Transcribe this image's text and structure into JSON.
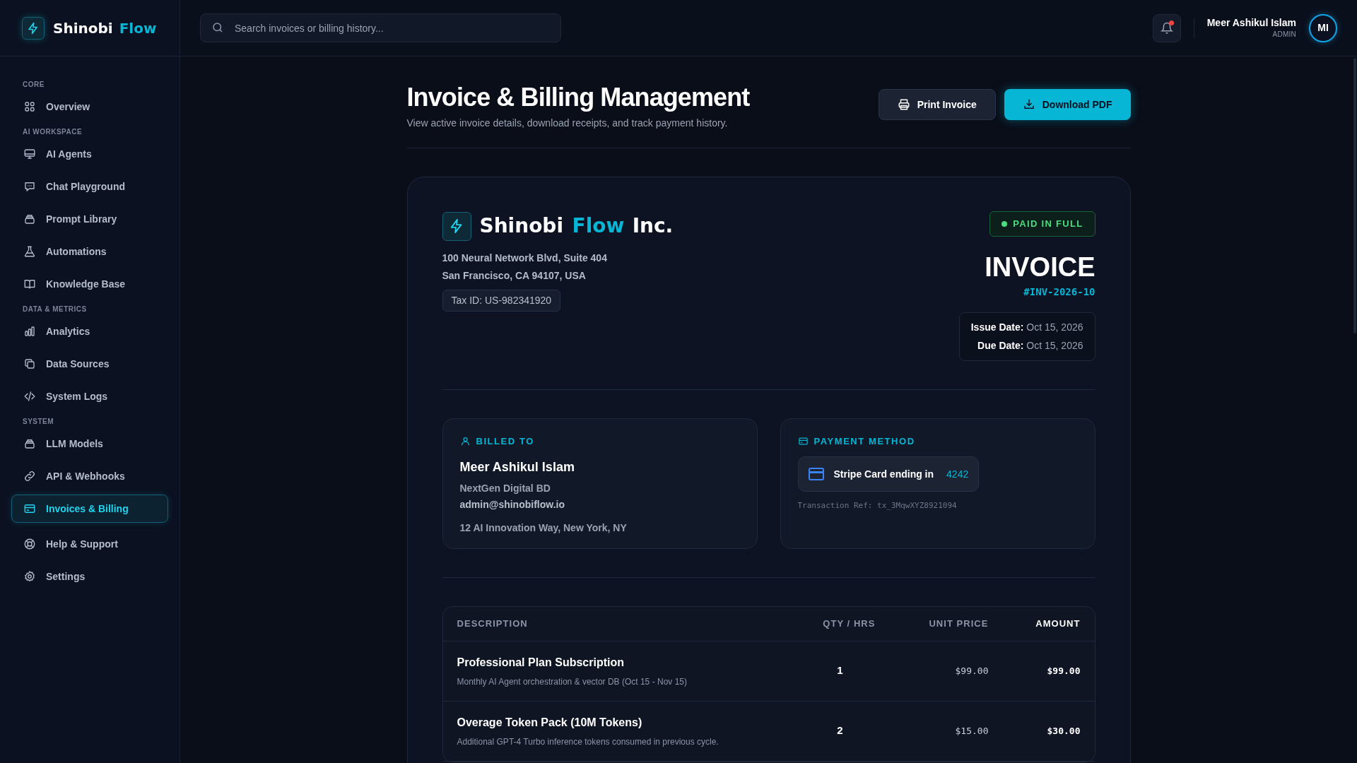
{
  "brand": {
    "name": "Shinobi",
    "accent": "Flow"
  },
  "search": {
    "placeholder": "Search invoices or billing history..."
  },
  "header": {
    "notifications": {
      "unread": true
    },
    "user": {
      "name": "Meer Ashikul Islam",
      "role": "ADMIN",
      "initials": "MI"
    }
  },
  "sidebar": {
    "sections": [
      {
        "title": "CORE",
        "items": [
          {
            "label": "Overview",
            "selected": false
          }
        ]
      },
      {
        "title": "AI WORKSPACE",
        "items": [
          {
            "label": "AI Agents",
            "selected": false
          },
          {
            "label": "Chat Playground",
            "selected": false
          },
          {
            "label": "Prompt Library",
            "selected": false
          },
          {
            "label": "Automations",
            "selected": false
          },
          {
            "label": "Knowledge Base",
            "selected": false
          }
        ]
      },
      {
        "title": "DATA & METRICS",
        "items": [
          {
            "label": "Analytics",
            "selected": false
          },
          {
            "label": "Data Sources",
            "selected": false
          },
          {
            "label": "System Logs",
            "selected": false
          }
        ]
      },
      {
        "title": "SYSTEM",
        "items": [
          {
            "label": "LLM Models",
            "selected": false
          },
          {
            "label": "API & Webhooks",
            "selected": false
          },
          {
            "label": "Invoices & Billing",
            "selected": true
          }
        ]
      },
      {
        "items": [
          {
            "label": "Help & Support",
            "selected": false
          },
          {
            "label": "Settings",
            "selected": false
          }
        ]
      }
    ]
  },
  "page": {
    "title": "Invoice & Billing Management",
    "subtitle": "View active invoice details, download receipts, and track payment history.",
    "buttons": [
      {
        "label": "Print Invoice",
        "kind": "secondary"
      },
      {
        "label": "Download PDF",
        "kind": "primary"
      }
    ]
  },
  "invoice": {
    "company": {
      "name": "Shinobi",
      "accent": "Flow",
      "suffix": "Inc.",
      "address": [
        "100 Neural Network Blvd, Suite 404",
        "San Francisco, CA 94107, USA"
      ],
      "tax_id": "Tax ID: US-982341920"
    },
    "status": "PAID IN FULL",
    "heading": "INVOICE",
    "number": "#INV-2026-10",
    "dates": [
      {
        "label": "Issue Date:",
        "value": "Oct 15, 2026"
      },
      {
        "label": "Due Date:",
        "value": "Oct 15, 2026"
      }
    ],
    "billed_to": {
      "title": "BILLED TO",
      "name": "Meer Ashikul Islam",
      "company": "NextGen Digital BD",
      "email": "admin@shinobiflow.io",
      "address": "12 AI Innovation Way, New York, NY"
    },
    "payment_method": {
      "title": "PAYMENT METHOD",
      "card": "Stripe Card ending in",
      "last4": "4242",
      "reference": "Transaction Ref: tx_3MqwXYZ8921094"
    },
    "table": {
      "columns": [
        "DESCRIPTION",
        "QTY / HRS",
        "UNIT PRICE",
        "AMOUNT"
      ],
      "rows": [
        {
          "title": "Professional Plan Subscription",
          "detail": "Monthly AI Agent orchestration & vector DB (Oct 15 - Nov 15)",
          "qty": "1",
          "unit_price": "$99.00",
          "amount": "$99.00"
        },
        {
          "title": "Overage Token Pack (10M Tokens)",
          "detail": "Additional GPT-4 Turbo inference tokens consumed in previous cycle.",
          "qty": "2",
          "unit_price": "$15.00",
          "amount": "$30.00"
        }
      ]
    }
  }
}
